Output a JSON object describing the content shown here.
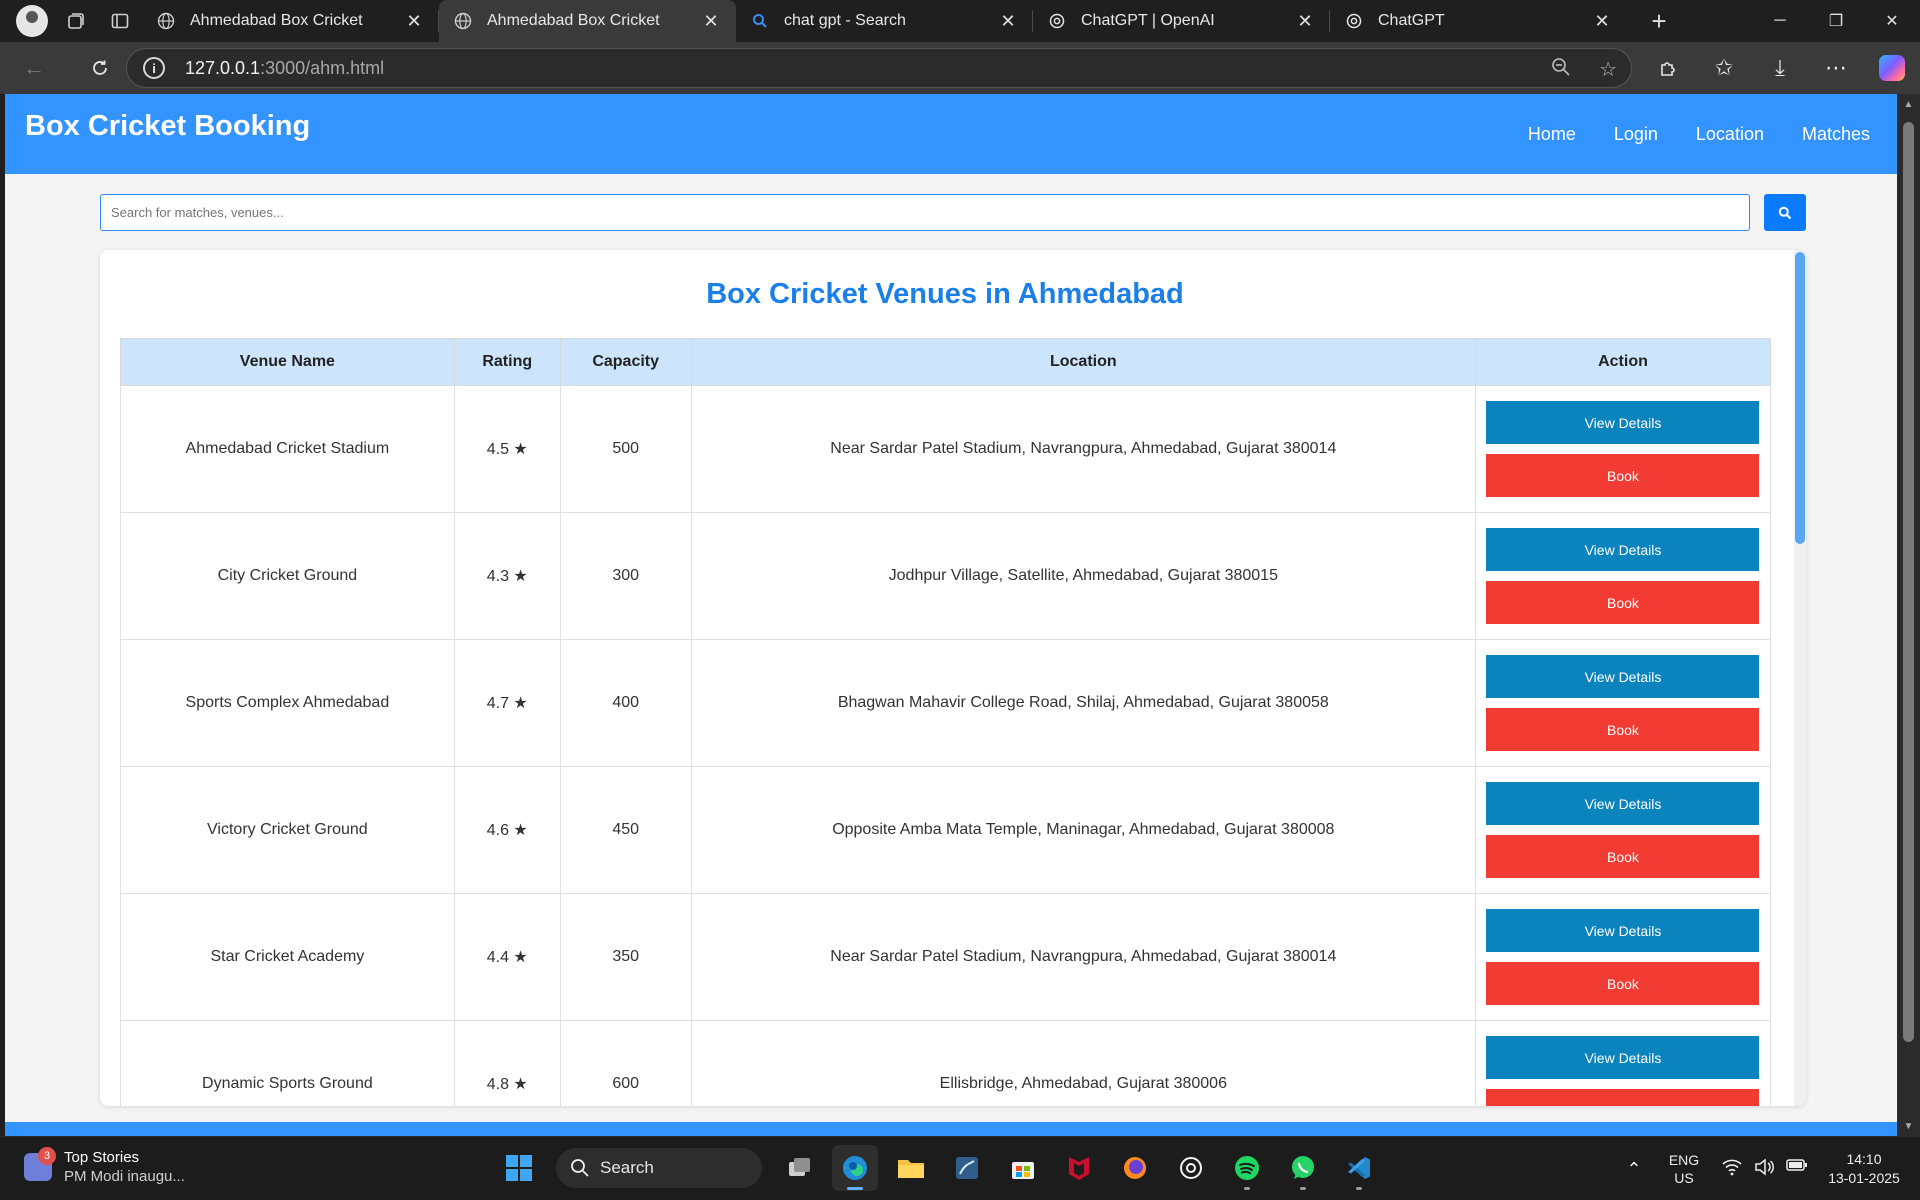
{
  "browser": {
    "tabs": [
      {
        "title": "Ahmedabad Box Cricket",
        "icon": "globe-icon",
        "active": false
      },
      {
        "title": "Ahmedabad Box Cricket",
        "icon": "globe-icon",
        "active": true
      },
      {
        "title": "chat gpt - Search",
        "icon": "search-icon",
        "active": false
      },
      {
        "title": "ChatGPT | OpenAI",
        "icon": "openai-icon",
        "active": false
      },
      {
        "title": "ChatGPT",
        "icon": "openai-icon",
        "active": false
      }
    ],
    "url_host": "127.0.0.1",
    "url_path": ":3000/ahm.html"
  },
  "site": {
    "title": "Box Cricket Booking",
    "nav": [
      "Home",
      "Login",
      "Location",
      "Matches"
    ],
    "search_placeholder": "Search for matches, venues...",
    "heading": "Box Cricket Venues in Ahmedabad",
    "columns": [
      "Venue Name",
      "Rating",
      "Capacity",
      "Location",
      "Action"
    ],
    "view_label": "View Details",
    "book_label": "Book",
    "venues": [
      {
        "name": "Ahmedabad Cricket Stadium",
        "rating": "4.5 ★",
        "capacity": "500",
        "location": "Near Sardar Patel Stadium, Navrangpura, Ahmedabad, Gujarat 380014"
      },
      {
        "name": "City Cricket Ground",
        "rating": "4.3 ★",
        "capacity": "300",
        "location": "Jodhpur Village, Satellite, Ahmedabad, Gujarat 380015"
      },
      {
        "name": "Sports Complex Ahmedabad",
        "rating": "4.7 ★",
        "capacity": "400",
        "location": "Bhagwan Mahavir College Road, Shilaj, Ahmedabad, Gujarat 380058"
      },
      {
        "name": "Victory Cricket Ground",
        "rating": "4.6 ★",
        "capacity": "450",
        "location": "Opposite Amba Mata Temple, Maninagar, Ahmedabad, Gujarat 380008"
      },
      {
        "name": "Star Cricket Academy",
        "rating": "4.4 ★",
        "capacity": "350",
        "location": "Near Sardar Patel Stadium, Navrangpura, Ahmedabad, Gujarat 380014"
      },
      {
        "name": "Dynamic Sports Ground",
        "rating": "4.8 ★",
        "capacity": "600",
        "location": "Ellisbridge, Ahmedabad, Gujarat 380006"
      }
    ],
    "colors": {
      "header": "#3393ff",
      "heading": "#1a7fe8",
      "view_button": "#0b84be",
      "book_button": "#f23b33",
      "table_header": "#cce4fc"
    }
  },
  "taskbar": {
    "news_title": "Top Stories",
    "news_sub": "PM Modi inaugu...",
    "news_badge": "3",
    "search_label": "Search",
    "lang_1": "ENG",
    "lang_2": "US",
    "time": "14:10",
    "date": "13-01-2025",
    "apps": [
      "windows-start-icon",
      "search-box",
      "task-view-icon",
      "edge-icon",
      "file-explorer-icon",
      "sql-tool-icon",
      "store-icon",
      "mcafee-icon",
      "firefox-icon",
      "chatgpt-icon",
      "spotify-icon",
      "whatsapp-icon",
      "vscode-icon"
    ]
  }
}
